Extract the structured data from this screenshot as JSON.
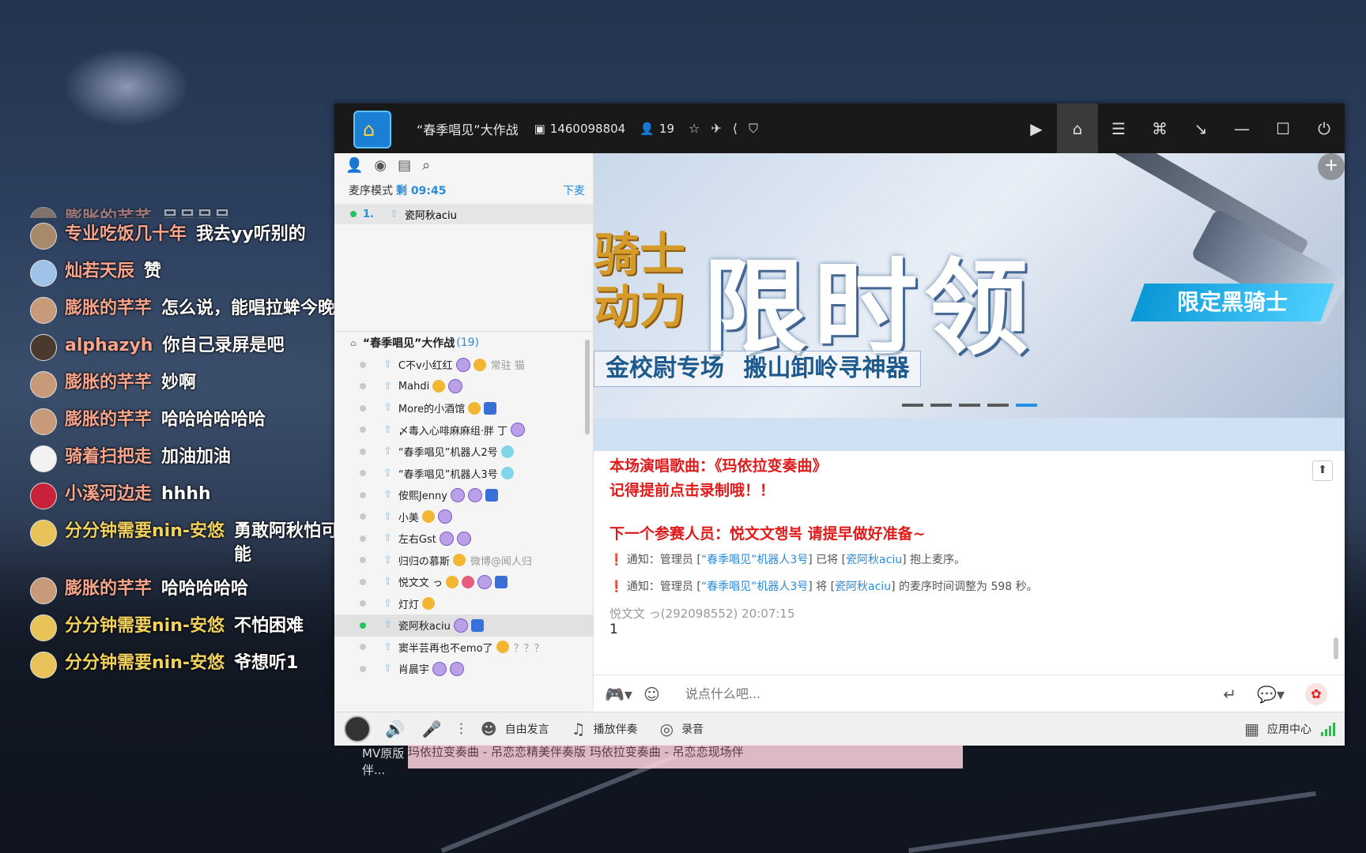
{
  "danmaku": [
    {
      "name": "膨胀的芊芊",
      "text": "吕吕吕吕",
      "avatar": "#c79b7a",
      "cut": true,
      "gold": false
    },
    {
      "name": "专业吃饭几十年",
      "text": "我去yy听别的",
      "avatar": "#a78a6a",
      "gold": false
    },
    {
      "name": "灿若天辰",
      "text": "赞",
      "avatar": "#9ec2e8",
      "gold": false
    },
    {
      "name": "膨胀的芊芊",
      "text": "怎么说，能唱拉蛑今晚",
      "avatar": "#c79b7a",
      "gold": false
    },
    {
      "name": "alphazyh",
      "text": "你自己录屏是吧",
      "avatar": "#4a3a2e",
      "gold": false
    },
    {
      "name": "膨胀的芊芊",
      "text": "妙啊",
      "avatar": "#c79b7a",
      "gold": false
    },
    {
      "name": "膨胀的芊芊",
      "text": "哈哈哈哈哈哈",
      "avatar": "#c79b7a",
      "gold": false
    },
    {
      "name": "骑着扫把走",
      "text": "加油加油",
      "avatar": "#f2f2f2",
      "gold": false
    },
    {
      "name": "小溪河边走",
      "text": "hhhh",
      "avatar": "#c8213a",
      "gold": false
    },
    {
      "name": "分分钟需要nin-安悠",
      "text": "勇敢阿秋怕可能",
      "avatar": "#e8c35a",
      "gold": true
    },
    {
      "name": "膨胀的芊芊",
      "text": "哈哈哈哈哈",
      "avatar": "#c79b7a",
      "gold": false
    },
    {
      "name": "分分钟需要nin-安悠",
      "text": "不怕困难",
      "avatar": "#e8c35a",
      "gold": true
    },
    {
      "name": "分分钟需要nin-安悠",
      "text": "爷想听1",
      "avatar": "#e8c35a",
      "gold": true
    }
  ],
  "titlebar": {
    "title": "“春季唱见”大作战",
    "room_id": "1460098804",
    "users": "19"
  },
  "left": {
    "mode_label": "麦序模式",
    "remaining": "剩 09:45",
    "down_label": "下麦",
    "queue": [
      {
        "num": "1.",
        "name": "瓷阿秋aciu"
      }
    ],
    "room_name": "“春季唱见”大作战",
    "room_count": "(19)",
    "members": [
      {
        "name": "C不v小红红",
        "extra": "常驻 猫",
        "sel": false
      },
      {
        "name": "Mahdi",
        "extra": "",
        "sel": false
      },
      {
        "name": "More的小酒馆",
        "extra": "",
        "sel": false
      },
      {
        "name": "〆毒入心啡麻麻组·胖 丁",
        "extra": "",
        "sel": false
      },
      {
        "name": "“春季唱见”机器人2号",
        "extra": "",
        "sel": false
      },
      {
        "name": "“春季唱见”机器人3号",
        "extra": "",
        "sel": false
      },
      {
        "name": "侒熙Jenny",
        "extra": "",
        "sel": false
      },
      {
        "name": "小美",
        "extra": "",
        "sel": false
      },
      {
        "name": "左右Gst",
        "extra": "",
        "sel": false
      },
      {
        "name": "归归の慕斯",
        "extra": "微博@闻人归",
        "sel": false
      },
      {
        "name": "悦文文 っ",
        "extra": "",
        "sel": false
      },
      {
        "name": "灯灯",
        "extra": "",
        "sel": false
      },
      {
        "name": "瓷阿秋aciu",
        "extra": "",
        "sel": true
      },
      {
        "name": "窦半芸再也不emo了",
        "extra": "？？？",
        "sel": false
      },
      {
        "name": "肖晨宇",
        "extra": "",
        "sel": false
      }
    ]
  },
  "banner": {
    "gold_line1": "骑士",
    "gold_line2": "动力",
    "big": "限时领",
    "sub_left": "金校尉专场",
    "sub_right": "搬山卸岭寻神器",
    "tag": "限定黑骑士"
  },
  "chat": {
    "song_line": "本场演唱歌曲：《玛依拉变奏曲》",
    "record_line": "记得提前点击录制哦！！",
    "next_line": "下一个参赛人员：悦文文행복 请提早做好准备~",
    "notice1": {
      "prefix": "通知：管理员 [",
      "who": "“春季唱见”机器人3号",
      "mid": "] 已将 [",
      "target": "瓷阿秋aciu",
      "suffix": "] 抱上麦序。"
    },
    "notice2": {
      "prefix": "通知：管理员 [",
      "who": "“春季唱见”机器人3号",
      "mid": "] 将 [",
      "target": "瓷阿秋aciu",
      "suffix": "] 的麦序时间调整为 598 秒。"
    },
    "msg_meta": "悦文文 っ(292098552)  20:07:15",
    "msg_text": "1"
  },
  "input": {
    "placeholder": "说点什么吧..."
  },
  "bottom": {
    "free_speak": "自由发言",
    "play_accompany": "播放伴奏",
    "record": "录音",
    "app_center": "应用中心"
  },
  "popup": {
    "left": "MV原版伴...",
    "text": "玛依拉变奏曲 - 吊恋恋精美伴奏版          玛依拉变奏曲 - 吊恋恋现场伴"
  }
}
